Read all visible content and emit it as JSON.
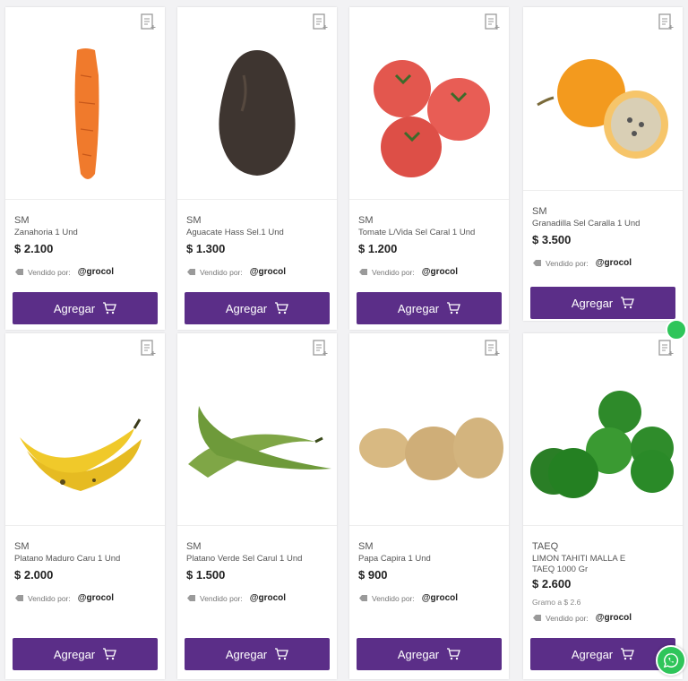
{
  "products": [
    {
      "brand": "SM",
      "name": "Zanahoria 1 Und",
      "price": "$ 2.100",
      "vendor_label": "Vendido por:",
      "seller": "@grocol",
      "button": "Agregar"
    },
    {
      "brand": "SM",
      "name": "Aguacate Hass Sel.1 Und",
      "price": "$ 1.300",
      "vendor_label": "Vendido por:",
      "seller": "@grocol",
      "button": "Agregar"
    },
    {
      "brand": "SM",
      "name": "Tomate L/Vida Sel Caral 1 Und",
      "price": "$ 1.200",
      "vendor_label": "Vendido por:",
      "seller": "@grocol",
      "button": "Agregar"
    },
    {
      "brand": "SM",
      "name": "Granadilla Sel Caralla 1 Und",
      "price": "$ 3.500",
      "vendor_label": "Vendido por:",
      "seller": "@grocol",
      "button": "Agregar"
    },
    {
      "brand": "SM",
      "name": "Platano Maduro Caru 1 Und",
      "price": "$ 2.000",
      "vendor_label": "Vendido por:",
      "seller": "@grocol",
      "button": "Agregar"
    },
    {
      "brand": "SM",
      "name": "Platano Verde Sel Carul 1 Und",
      "price": "$ 1.500",
      "vendor_label": "Vendido por:",
      "seller": "@grocol",
      "button": "Agregar"
    },
    {
      "brand": "SM",
      "name": "Papa Capira 1 Und",
      "price": "$ 900",
      "vendor_label": "Vendido por:",
      "seller": "@grocol",
      "button": "Agregar"
    },
    {
      "brand": "TAEQ",
      "name": "LIMON TAHITI MALLA E TAEQ 1000 Gr",
      "price": "$ 2.600",
      "unit_price": "Gramo a $ 2.6",
      "vendor_label": "Vendido por:",
      "seller": "@grocol",
      "button": "Agregar"
    }
  ],
  "colors": {
    "button": "#5b2e88",
    "whatsapp": "#2fc55a"
  },
  "icons": {
    "list": "shopping-list-icon",
    "tag": "tag-icon",
    "cart": "cart-icon",
    "chat": "whatsapp-icon"
  }
}
